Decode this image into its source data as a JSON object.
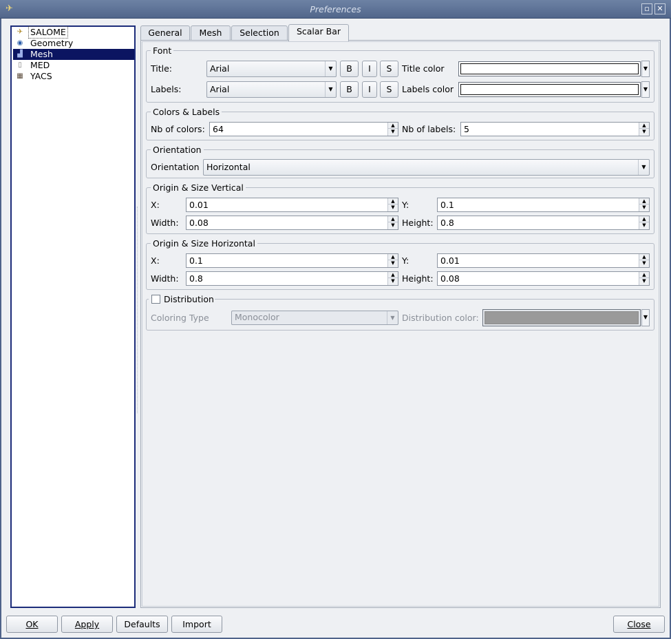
{
  "window": {
    "title": "Preferences"
  },
  "tree": [
    {
      "label": "SALOME",
      "icon": "salome-icon"
    },
    {
      "label": "Geometry",
      "icon": "geometry-icon"
    },
    {
      "label": "Mesh",
      "icon": "mesh-icon"
    },
    {
      "label": "MED",
      "icon": "med-icon"
    },
    {
      "label": "YACS",
      "icon": "yacs-icon"
    }
  ],
  "tabs": [
    "General",
    "Mesh",
    "Selection",
    "Scalar Bar"
  ],
  "font": {
    "group": "Font",
    "title_label": "Title:",
    "title_font": "Arial",
    "labels_label": "Labels:",
    "labels_font": "Arial",
    "bold": "B",
    "italic": "I",
    "shadow": "S",
    "title_color_label": "Title color",
    "labels_color_label": "Labels color",
    "title_color": "#ffffff",
    "labels_color": "#ffffff"
  },
  "colors_labels": {
    "group": "Colors & Labels",
    "nb_colors_label": "Nb of colors:",
    "nb_colors": "64",
    "nb_labels_label": "Nb of labels:",
    "nb_labels": "5"
  },
  "orientation": {
    "group": "Orientation",
    "label": "Orientation",
    "value": "Horizontal"
  },
  "origin_vertical": {
    "group": "Origin & Size Vertical",
    "x_label": "X:",
    "x": "0.01",
    "y_label": "Y:",
    "y": "0.1",
    "width_label": "Width:",
    "width": "0.08",
    "height_label": "Height:",
    "height": "0.8"
  },
  "origin_horizontal": {
    "group": "Origin & Size Horizontal",
    "x_label": "X:",
    "x": "0.1",
    "y_label": "Y:",
    "y": "0.01",
    "width_label": "Width:",
    "width": "0.8",
    "height_label": "Height:",
    "height": "0.08"
  },
  "distribution": {
    "group": "Distribution",
    "checked": false,
    "coloring_type_label": "Coloring Type",
    "coloring_type": "Monocolor",
    "color_label": "Distribution color:",
    "color": "#9a9a9a"
  },
  "buttons": {
    "ok": "OK",
    "apply": "Apply",
    "defaults": "Defaults",
    "import": "Import",
    "close": "Close"
  }
}
